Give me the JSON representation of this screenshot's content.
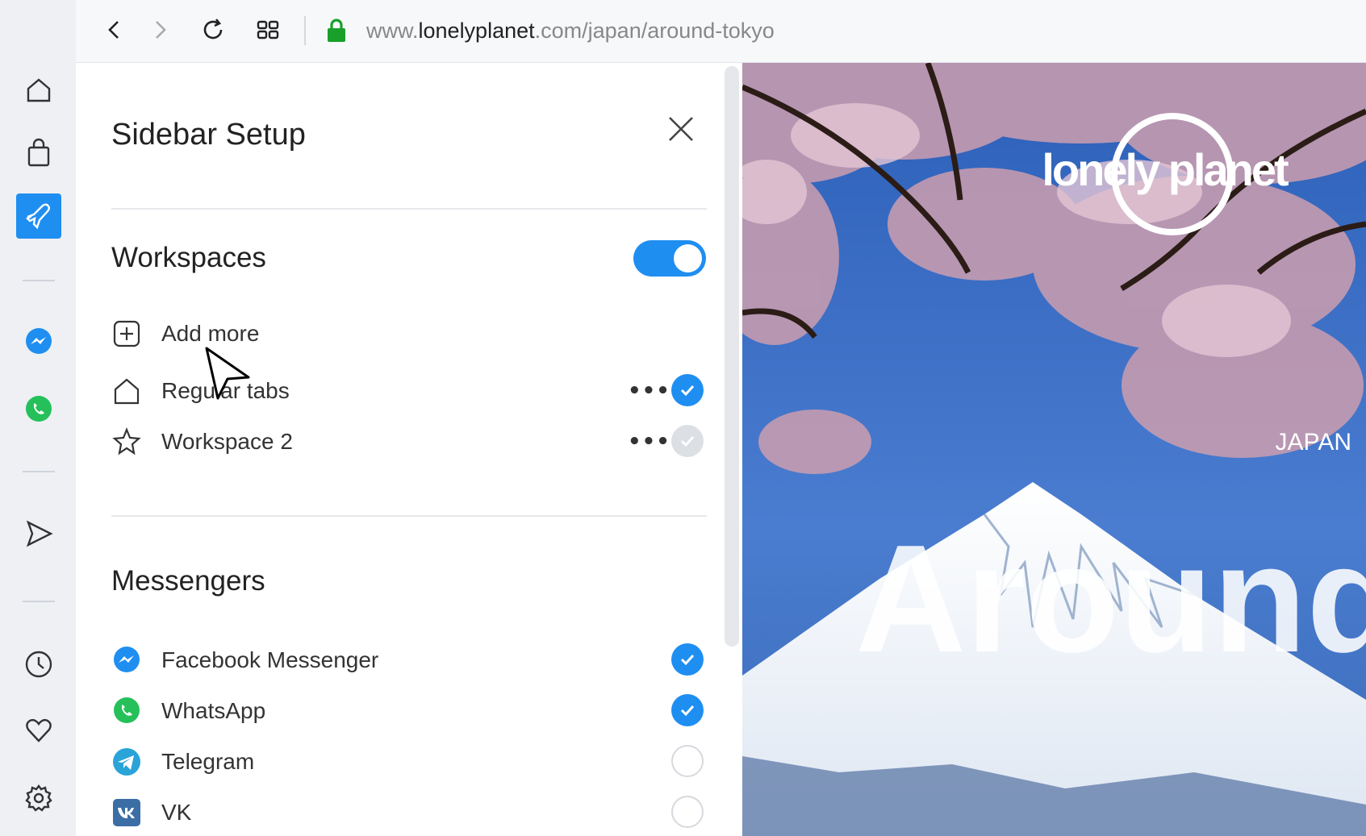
{
  "browser": {
    "url_domain_prefix": "www.",
    "url_domain": "lonelyplanet",
    "url_rest": ".com/japan/around-tokyo"
  },
  "rail": {
    "items": [
      "home-icon",
      "bag-icon",
      "plane-icon",
      "messenger-icon",
      "whatsapp-icon",
      "send-icon",
      "clock-icon",
      "heart-icon",
      "gear-icon"
    ],
    "active": "plane-icon",
    "accent": "#1f8ef1"
  },
  "panel": {
    "title": "Sidebar Setup",
    "workspaces": {
      "title": "Workspaces",
      "enabled": true,
      "add_more": "Add more",
      "items": [
        {
          "label": "Regular tabs",
          "icon": "home-icon",
          "checked": true
        },
        {
          "label": "Workspace 2",
          "icon": "star-icon",
          "checked": true,
          "dimmed": true
        }
      ],
      "more_label": "•••"
    },
    "messengers": {
      "title": "Messengers",
      "items": [
        {
          "label": "Facebook Messenger",
          "icon": "messenger-icon",
          "checked": true
        },
        {
          "label": "WhatsApp",
          "icon": "whatsapp-icon",
          "checked": true
        },
        {
          "label": "Telegram",
          "icon": "telegram-icon",
          "checked": false
        },
        {
          "label": "VK",
          "icon": "vk-icon",
          "checked": false
        }
      ]
    }
  },
  "page": {
    "logo_text": "lonely planet",
    "country": "JAPAN",
    "headline": "Around"
  },
  "colors": {
    "accent": "#1f8ef1",
    "sky": "#3f6fc4",
    "whatsapp": "#25c05a",
    "telegram": "#2aa3d9",
    "vk": "#3c6ea6"
  }
}
